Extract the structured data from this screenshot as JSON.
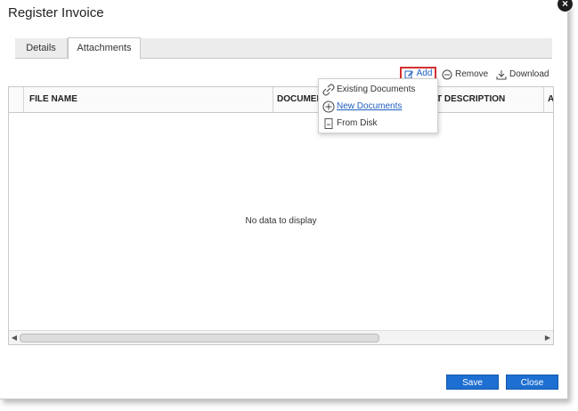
{
  "dialog": {
    "title": "Register Invoice",
    "close_icon": "close-icon"
  },
  "tabs": [
    {
      "label": "Details",
      "active": false
    },
    {
      "label": "Attachments",
      "active": true
    }
  ],
  "toolbar": {
    "add_label": "Add",
    "remove_label": "Remove",
    "download_label": "Download"
  },
  "grid": {
    "columns": [
      "",
      "FILE NAME",
      "DOCUMENT",
      "T DESCRIPTION",
      "A"
    ],
    "empty_text": "No data to display"
  },
  "menu": {
    "items": [
      {
        "label": "Existing Documents",
        "icon": "link-icon"
      },
      {
        "label": "New Documents",
        "icon": "plus-circle-icon"
      },
      {
        "label": "From Disk",
        "icon": "file-icon"
      }
    ]
  },
  "footer": {
    "save_label": "Save",
    "close_label": "Close"
  },
  "colors": {
    "accent": "#1d6fd1",
    "highlight_border": "#d32f2f",
    "link": "#1f5fbf"
  }
}
